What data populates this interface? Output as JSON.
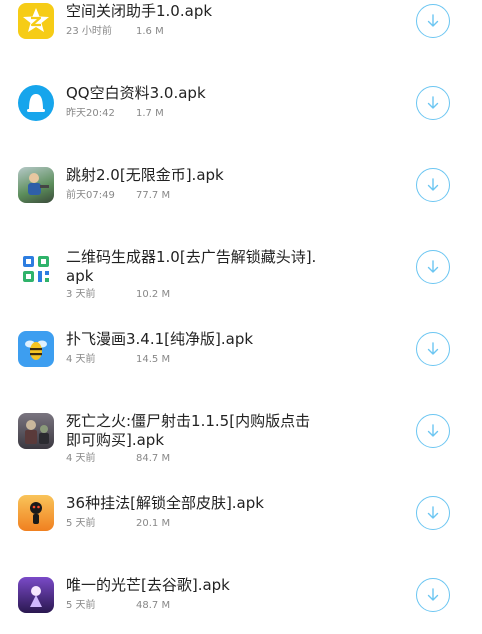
{
  "files": [
    {
      "name": "空间关闭助手1.0.apk",
      "time": "23 小时前",
      "size": "1.6 M",
      "icon": "qzone-star-icon",
      "color": "#f6cc16"
    },
    {
      "name": "QQ空白资料3.0.apk",
      "time": "昨天20:42",
      "size": "1.7 M",
      "icon": "qq-bell-icon",
      "color": "#16a5ec"
    },
    {
      "name": "跳射2.0[无限金币].apk",
      "time": "前天07:49",
      "size": "77.7 M",
      "icon": "game-character-icon",
      "color": "#5b8d5a"
    },
    {
      "name": "二维码生成器1.0[去广告解锁藏头诗].apk",
      "time": "3 天前",
      "size": "10.2 M",
      "icon": "qr-code-icon",
      "color": "#2d7de0"
    },
    {
      "name": "扑飞漫画3.4.1[纯净版].apk",
      "time": "4 天前",
      "size": "14.5 M",
      "icon": "bee-icon",
      "color": "#3d9ef0"
    },
    {
      "name": "死亡之火:僵尸射击1.1.5[内购版点击即可购买].apk",
      "time": "4 天前",
      "size": "84.7 M",
      "icon": "zombie-game-icon",
      "color": "#4d4a52"
    },
    {
      "name": "36种挂法[解锁全部皮肤].apk",
      "time": "5 天前",
      "size": "20.1 M",
      "icon": "stickman-icon",
      "color": "#f08020"
    },
    {
      "name": "唯一的光芒[去谷歌].apk",
      "time": "5 天前",
      "size": "48.7 M",
      "icon": "light-game-icon",
      "color": "#4a2a8a"
    }
  ],
  "download_icon": "download-arrow-icon",
  "accent": "#6cc6f2"
}
